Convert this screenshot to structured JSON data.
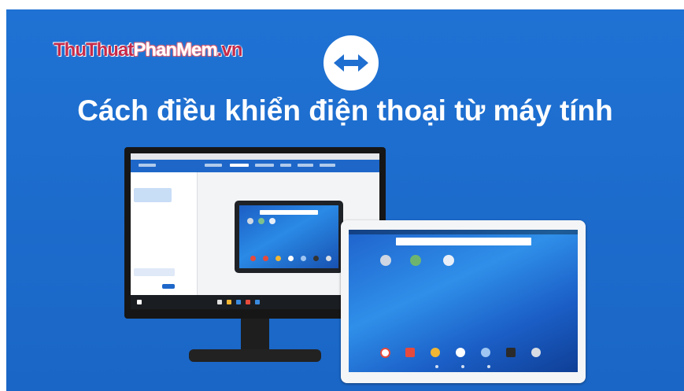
{
  "watermark": {
    "part1": "ThuThuat",
    "part2": "PhanMem",
    "part3": ".vn"
  },
  "headline": "Cách điều khiển điện thoại từ máy tính",
  "colors": {
    "background": "#1f72d3",
    "watermark_red": "#c42a4a",
    "logo_arrow": "#1f6fd0"
  },
  "icons": [
    "teamviewer-logo-icon",
    "monitor-icon",
    "tablet-icon"
  ]
}
